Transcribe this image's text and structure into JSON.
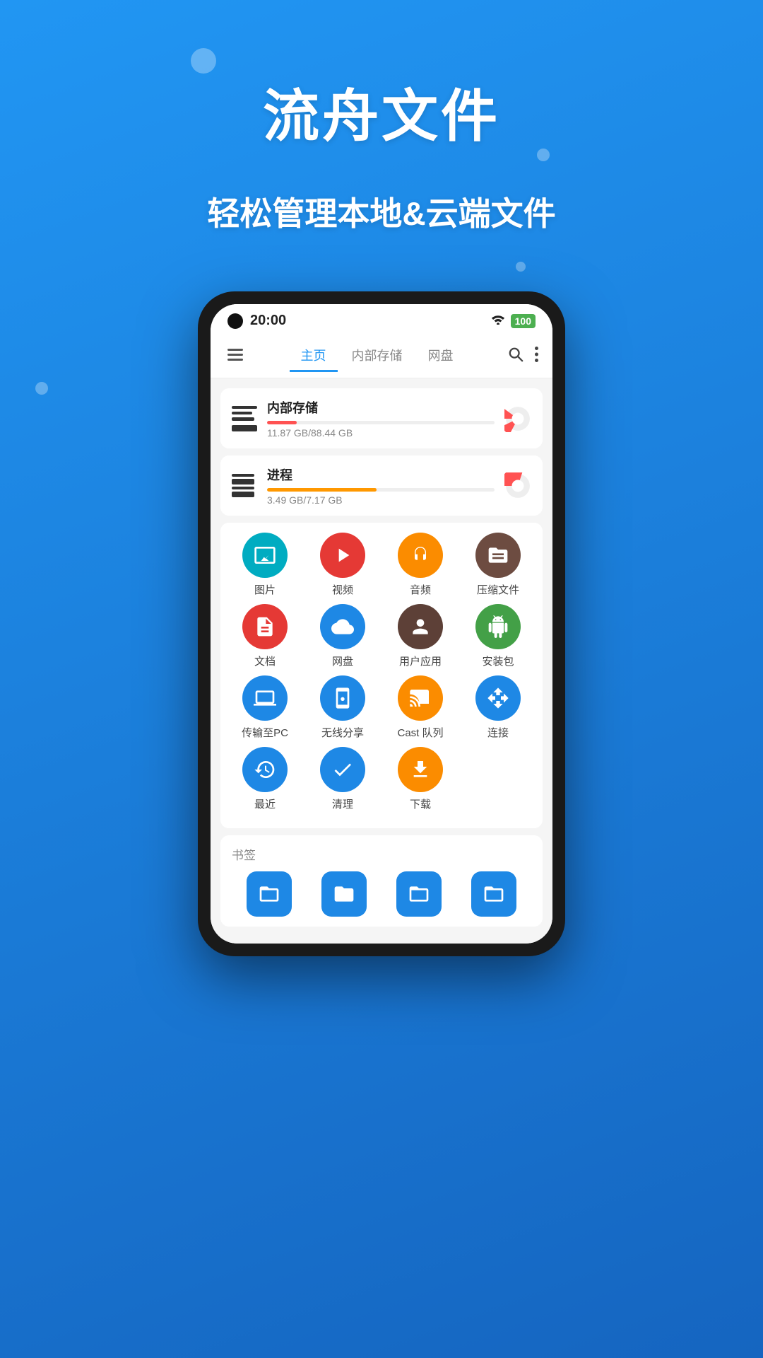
{
  "app": {
    "title": "流舟文件",
    "subtitle": "轻松管理本地&云端文件"
  },
  "status_bar": {
    "time": "20:00",
    "wifi": "📶",
    "battery": "100"
  },
  "nav": {
    "menu_label": "≡",
    "tabs": [
      {
        "id": "home",
        "label": "主页",
        "active": true
      },
      {
        "id": "internal",
        "label": "内部存储",
        "active": false
      },
      {
        "id": "cloud",
        "label": "网盘",
        "active": false
      }
    ],
    "search_label": "🔍",
    "more_label": "⋮"
  },
  "storage": [
    {
      "id": "internal",
      "title": "内部存储",
      "percent": 13,
      "percent_label": "13%",
      "usage": "11.87 GB/88.44 GB",
      "progress_color": "#FF5252",
      "chart_color1": "#FF5252",
      "chart_color2": "#eee"
    },
    {
      "id": "process",
      "title": "进程",
      "percent": 48,
      "percent_label": "48%",
      "usage": "3.49 GB/7.17 GB",
      "progress_color": "#FF9800",
      "chart_color1": "#FF5252",
      "chart_color2": "#eee"
    }
  ],
  "icon_grid": [
    [
      {
        "id": "photos",
        "label": "图片",
        "color": "#00ACC1",
        "icon": "🖼"
      },
      {
        "id": "video",
        "label": "视频",
        "color": "#E53935",
        "icon": "▶"
      },
      {
        "id": "audio",
        "label": "音频",
        "color": "#FB8C00",
        "icon": "🎧"
      },
      {
        "id": "archive",
        "label": "压缩文件",
        "color": "#6D4C41",
        "icon": "📦"
      }
    ],
    [
      {
        "id": "docs",
        "label": "文档",
        "color": "#E53935",
        "icon": "📄"
      },
      {
        "id": "netdisk",
        "label": "网盘",
        "color": "#1E88E5",
        "icon": "☁"
      },
      {
        "id": "apps",
        "label": "用户应用",
        "color": "#5D4037",
        "icon": "👤"
      },
      {
        "id": "apk",
        "label": "安装包",
        "color": "#43A047",
        "icon": "🤖"
      }
    ],
    [
      {
        "id": "transfer",
        "label": "传输至PC",
        "color": "#1E88E5",
        "icon": "💻"
      },
      {
        "id": "wireless",
        "label": "无线分享",
        "color": "#1E88E5",
        "icon": "📱"
      },
      {
        "id": "cast",
        "label": "Cast 队列",
        "color": "#FB8C00",
        "icon": "📡"
      },
      {
        "id": "connect",
        "label": "连接",
        "color": "#1E88E5",
        "icon": "↔"
      }
    ],
    [
      {
        "id": "recent",
        "label": "最近",
        "color": "#1E88E5",
        "icon": "🕐"
      },
      {
        "id": "clean",
        "label": "清理",
        "color": "#1E88E5",
        "icon": "✓"
      },
      {
        "id": "download",
        "label": "下载",
        "color": "#FB8C00",
        "icon": "⬇"
      }
    ]
  ],
  "bookmarks": {
    "title": "书签",
    "items": [
      {
        "id": "bk1",
        "color": "#1E88E5",
        "icon": "📁"
      },
      {
        "id": "bk2",
        "color": "#1E88E5",
        "icon": "📂"
      },
      {
        "id": "bk3",
        "color": "#1E88E5",
        "icon": "📁"
      },
      {
        "id": "bk4",
        "color": "#1E88E5",
        "icon": "📁"
      }
    ]
  }
}
